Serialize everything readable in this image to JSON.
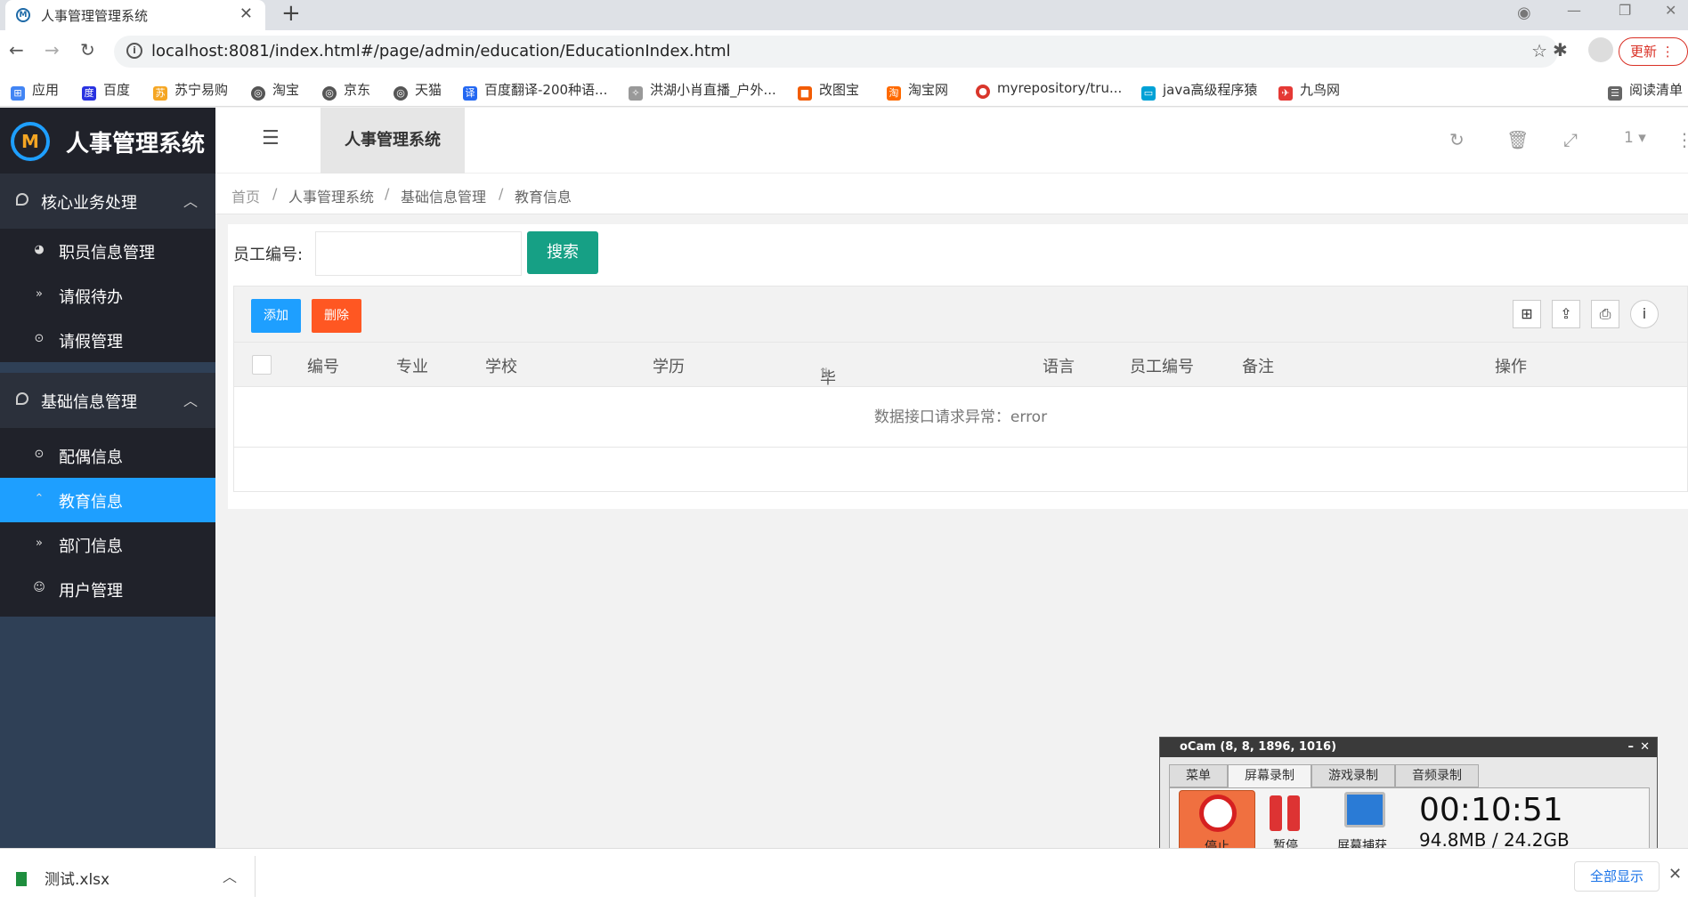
{
  "browser": {
    "tab_title": "人事管理管理系统",
    "url": "localhost:8081/index.html#/page/admin/education/EducationIndex.html",
    "update_label": "更新",
    "bookmarks": [
      "应用",
      "百度",
      "苏宁易购",
      "淘宝",
      "京东",
      "天猫",
      "百度翻译-200种语...",
      "洪湖小肖直播_户外...",
      "改图宝",
      "淘宝网",
      "myrepository/tru...",
      "java高级程序猿",
      "九鸟网"
    ],
    "reading_list": "阅读清单"
  },
  "app": {
    "logo_text": "人事管理系统",
    "header_tab": "人事管理系统",
    "header_page_num": "1"
  },
  "sidebar": {
    "groups": [
      {
        "label": "核心业务处理",
        "items": [
          "职员信息管理",
          "请假待办",
          "请假管理"
        ]
      },
      {
        "label": "基础信息管理",
        "items": [
          "配偶信息",
          "教育信息",
          "部门信息",
          "用户管理"
        ]
      }
    ],
    "active_item": "教育信息"
  },
  "breadcrumb": [
    "首页",
    "人事管理系统",
    "基础信息管理",
    "教育信息"
  ],
  "search": {
    "label": "员工编号:",
    "value": "",
    "button": "搜索"
  },
  "toolbar": {
    "add": "添加",
    "delete": "删除"
  },
  "table": {
    "columns": [
      "编号",
      "专业",
      "学校",
      "学历",
      "毕业时间",
      "语言",
      "员工编号",
      "备注",
      "操作"
    ],
    "empty_message": "数据接口请求异常：error"
  },
  "ocam": {
    "title": "oCam (8, 8, 1896, 1016)",
    "tabs": [
      "菜单",
      "屏幕录制",
      "游戏录制",
      "音频录制"
    ],
    "stop": "停止",
    "pause": "暂停",
    "capture": "屏幕捕获",
    "timer": "00:10:51",
    "size": "94.8MB / 24.2GB"
  },
  "downloads": {
    "file": "测试.xlsx",
    "show_all": "全部显示"
  },
  "colors": {
    "sidebar": "#2f4056",
    "active": "#1e9fff",
    "search_btn": "#16a085",
    "add_btn": "#1e9fff",
    "delete_btn": "#ff5722"
  }
}
